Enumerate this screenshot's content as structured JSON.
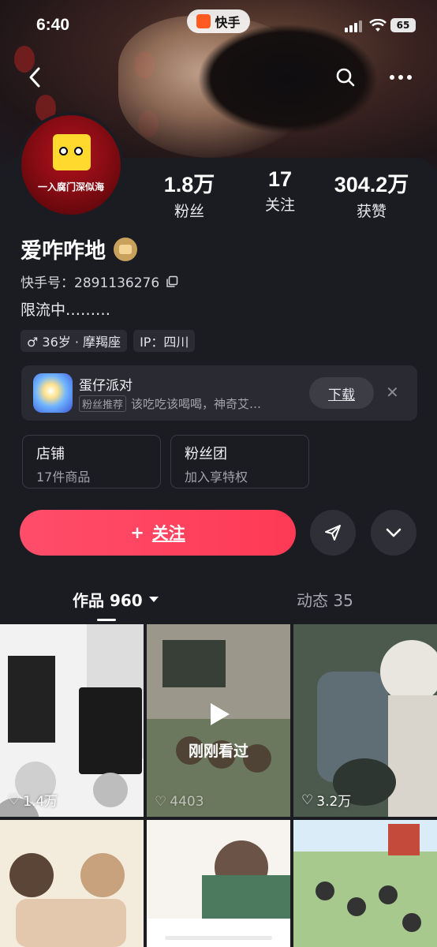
{
  "status_bar": {
    "time": "6:40",
    "app_badge": "快手",
    "battery": "65"
  },
  "nav": {
    "back_icon": "chevron-left-icon",
    "search_icon": "search-icon",
    "more_icon": "more-horizontal-icon"
  },
  "profile": {
    "avatar_text": "一入腐门深似海",
    "name": "爱咋咋地",
    "kuaishou_id_label": "快手号：",
    "kuaishou_id": "2891136276",
    "bio": "限流中………",
    "tags": [
      "♂ 36岁 · 摩羯座",
      "IP：四川"
    ],
    "stats": [
      {
        "value": "1.8万",
        "label": "粉丝"
      },
      {
        "value": "17",
        "label": "关注"
      },
      {
        "value": "304.2万",
        "label": "获赞"
      }
    ]
  },
  "ad": {
    "title": "蛋仔派对",
    "chip": "粉丝推荐",
    "subtitle": "该吃吃该喝喝，神奇艾…",
    "download_label": "下载"
  },
  "shortcuts": [
    {
      "title": "店铺",
      "sub": "17件商品"
    },
    {
      "title": "粉丝团",
      "sub": "加入享特权"
    }
  ],
  "actions": {
    "follow_label": "关注",
    "follow_prefix": "+"
  },
  "tabs": {
    "works": "作品 960",
    "moments": "动态 35"
  },
  "grid": {
    "items": [
      {
        "likes": "1.4万"
      },
      {
        "likes": "4403",
        "overlay": "刚刚看过"
      },
      {
        "likes": "3.2万"
      }
    ]
  },
  "colors": {
    "accent": "#fe3a55",
    "background": "#1b1b22",
    "card": "#2a2a32"
  }
}
